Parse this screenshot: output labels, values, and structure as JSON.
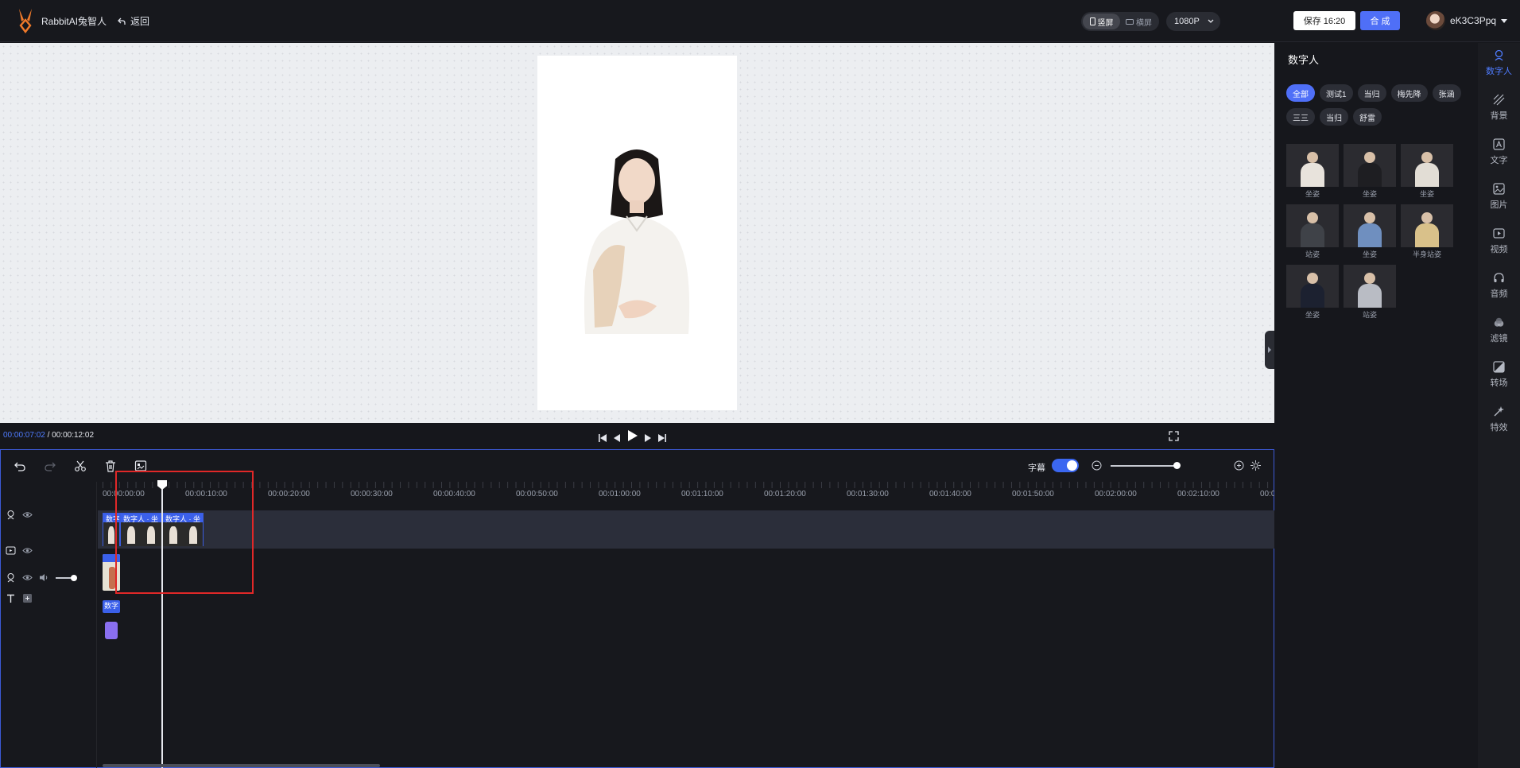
{
  "header": {
    "brand": "RabbitAI兔智人",
    "back_label": "返回",
    "portrait_label": "竖屏",
    "landscape_label": "横屏",
    "resolution": "1080P",
    "save_label": "保存 16:20",
    "compose_label": "合 成",
    "username": "eK3C3Ppq"
  },
  "player": {
    "current_time": "00:00:07:02",
    "separator": "/",
    "total_time": "00:00:12:02"
  },
  "timeline": {
    "subtitle_label": "字幕",
    "subtitle_enabled": true,
    "ticks": [
      "00:00:00:00",
      "00:00:10:00",
      "00:00:20:00",
      "00:00:30:00",
      "00:00:40:00",
      "00:00:50:00",
      "00:01:00:00",
      "00:01:10:00",
      "00:01:20:00",
      "00:01:30:00",
      "00:01:40:00",
      "00:01:50:00",
      "00:02:00:00",
      "00:02:10:00",
      "00:0"
    ],
    "clips": {
      "clip_a": "数字",
      "clip_b": "数字人 · 坐",
      "clip_c": "数字人 · 坐",
      "avatar_clip": "数字"
    }
  },
  "panel": {
    "title": "数字人",
    "categories": [
      "全部",
      "测试1",
      "当归",
      "梅先降",
      "张涵",
      "三三",
      "当归",
      "舒雷"
    ],
    "avatars": [
      {
        "label": "坐姿",
        "color": "#e8e3dc"
      },
      {
        "label": "坐姿",
        "color": "#1e1e22"
      },
      {
        "label": "坐姿",
        "color": "#e2ddd5"
      },
      {
        "label": "站姿",
        "color": "#3f4248"
      },
      {
        "label": "坐姿",
        "color": "#6f8fbf"
      },
      {
        "label": "半身站姿",
        "color": "#d9c18a"
      },
      {
        "label": "坐姿",
        "color": "#1c2130"
      },
      {
        "label": "站姿",
        "color": "#b9bcc4"
      }
    ]
  },
  "sidebar": [
    {
      "label": "数字人",
      "icon": "avatar-icon",
      "active": true
    },
    {
      "label": "背景",
      "icon": "background-icon"
    },
    {
      "label": "文字",
      "icon": "text-icon"
    },
    {
      "label": "图片",
      "icon": "image-icon"
    },
    {
      "label": "视频",
      "icon": "video-icon"
    },
    {
      "label": "音频",
      "icon": "headphones-icon"
    },
    {
      "label": "滤镜",
      "icon": "filter-icon"
    },
    {
      "label": "转场",
      "icon": "transition-icon"
    },
    {
      "label": "特效",
      "icon": "effects-icon"
    }
  ]
}
